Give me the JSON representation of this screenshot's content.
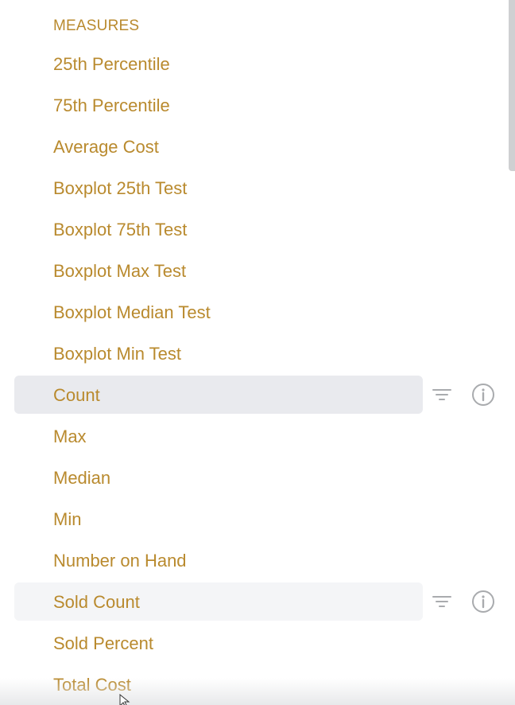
{
  "section": {
    "title": "MEASURES"
  },
  "fields": [
    {
      "label": "25th Percentile",
      "state": "normal"
    },
    {
      "label": "75th Percentile",
      "state": "normal"
    },
    {
      "label": "Average Cost",
      "state": "normal"
    },
    {
      "label": "Boxplot 25th Test",
      "state": "normal"
    },
    {
      "label": "Boxplot 75th Test",
      "state": "normal"
    },
    {
      "label": "Boxplot Max Test",
      "state": "normal"
    },
    {
      "label": "Boxplot Median Test",
      "state": "normal"
    },
    {
      "label": "Boxplot Min Test",
      "state": "normal"
    },
    {
      "label": "Count",
      "state": "hover"
    },
    {
      "label": "Max",
      "state": "normal"
    },
    {
      "label": "Median",
      "state": "normal"
    },
    {
      "label": "Min",
      "state": "normal"
    },
    {
      "label": "Number on Hand",
      "state": "normal"
    },
    {
      "label": "Sold Count",
      "state": "hover-light"
    },
    {
      "label": "Sold Percent",
      "state": "normal"
    },
    {
      "label": "Total Cost",
      "state": "normal"
    }
  ],
  "icons": {
    "filter": "filter-icon",
    "info": "info-icon"
  },
  "colors": {
    "measure_text": "#b98a2e",
    "hover_bg": "#e9eaee",
    "icon_gray": "#a9abae",
    "scrollbar": "#cfd0d2"
  }
}
